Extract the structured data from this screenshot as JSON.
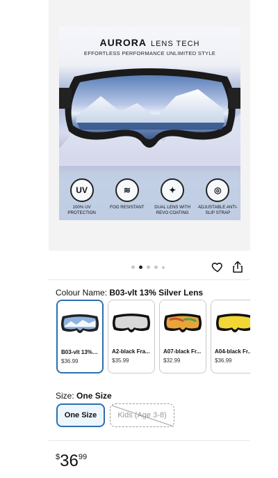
{
  "hero": {
    "brand": "AURORA",
    "brand_sub": "LENS TECH",
    "tagline": "EFFORTLESS PERFORMANCE UNLIMITED STYLE",
    "features": [
      {
        "icon": "uv-icon",
        "glyph": "UV",
        "label": "100% UV PROTECTION"
      },
      {
        "icon": "wind-icon",
        "glyph": "≋",
        "label": "FOG RESISTANT"
      },
      {
        "icon": "sparkle-icon",
        "glyph": "✦",
        "label": "DUAL LENS WITH REVO COATING"
      },
      {
        "icon": "strap-icon",
        "glyph": "◎",
        "label": "ADJUSTABLE ANTI-SLIP STRAP"
      }
    ]
  },
  "gallery": {
    "dots": 5,
    "active_dot": 2
  },
  "colour": {
    "label": "Colour Name:",
    "value": "B03-vlt 13% Silver Lens",
    "options": [
      {
        "name": "B03-vlt 13% S...",
        "price": "$36.99",
        "lens": "#8fb3e0",
        "frame": "#222"
      },
      {
        "name": "A2-black Fra...",
        "price": "$35.99",
        "lens": "#d8d8d8",
        "frame": "#111"
      },
      {
        "name": "A07-black Fr...",
        "price": "$32.99",
        "lens": "#e9a43a",
        "frame": "#111"
      },
      {
        "name": "A04-black Fr...",
        "price": "$36.99",
        "lens": "#f2d635",
        "frame": "#111"
      }
    ]
  },
  "size": {
    "label": "Size:",
    "value": "One Size",
    "options": [
      {
        "label": "One Size",
        "available": true
      },
      {
        "label": "Kids (Age 3-8)",
        "available": false
      }
    ]
  },
  "price": {
    "symbol": "$",
    "whole": "36",
    "fraction": "99"
  }
}
